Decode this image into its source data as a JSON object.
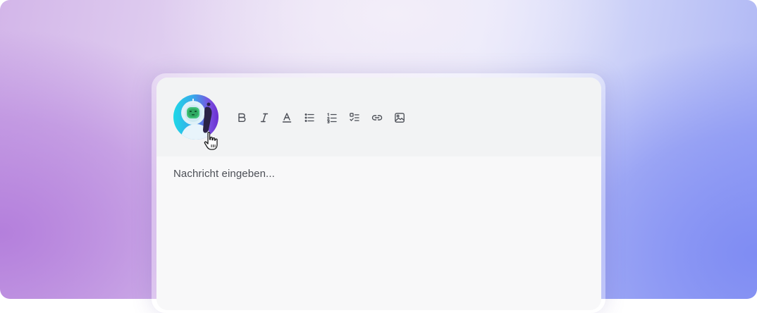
{
  "editor": {
    "placeholder": "Nachricht eingeben..."
  },
  "avatar": {
    "icon": "robot-avatar-icon"
  },
  "toolbar": {
    "tools": [
      {
        "name": "bold",
        "icon": "bold-icon",
        "glyph": "B"
      },
      {
        "name": "italic",
        "icon": "italic-icon",
        "glyph": "I"
      },
      {
        "name": "text-color",
        "icon": "text-color-icon",
        "glyph": "A"
      },
      {
        "name": "bullet-list",
        "icon": "bullet-list-icon"
      },
      {
        "name": "numbered-list",
        "icon": "numbered-list-icon"
      },
      {
        "name": "checklist",
        "icon": "checklist-icon"
      },
      {
        "name": "link",
        "icon": "link-icon"
      },
      {
        "name": "image",
        "icon": "image-icon"
      }
    ]
  },
  "colors": {
    "background_left": "#b47fdc",
    "background_right": "#7f8cf3",
    "card": "#f8f8f9",
    "toolbar": "#f2f3f4",
    "icon": "#4a4d55"
  }
}
